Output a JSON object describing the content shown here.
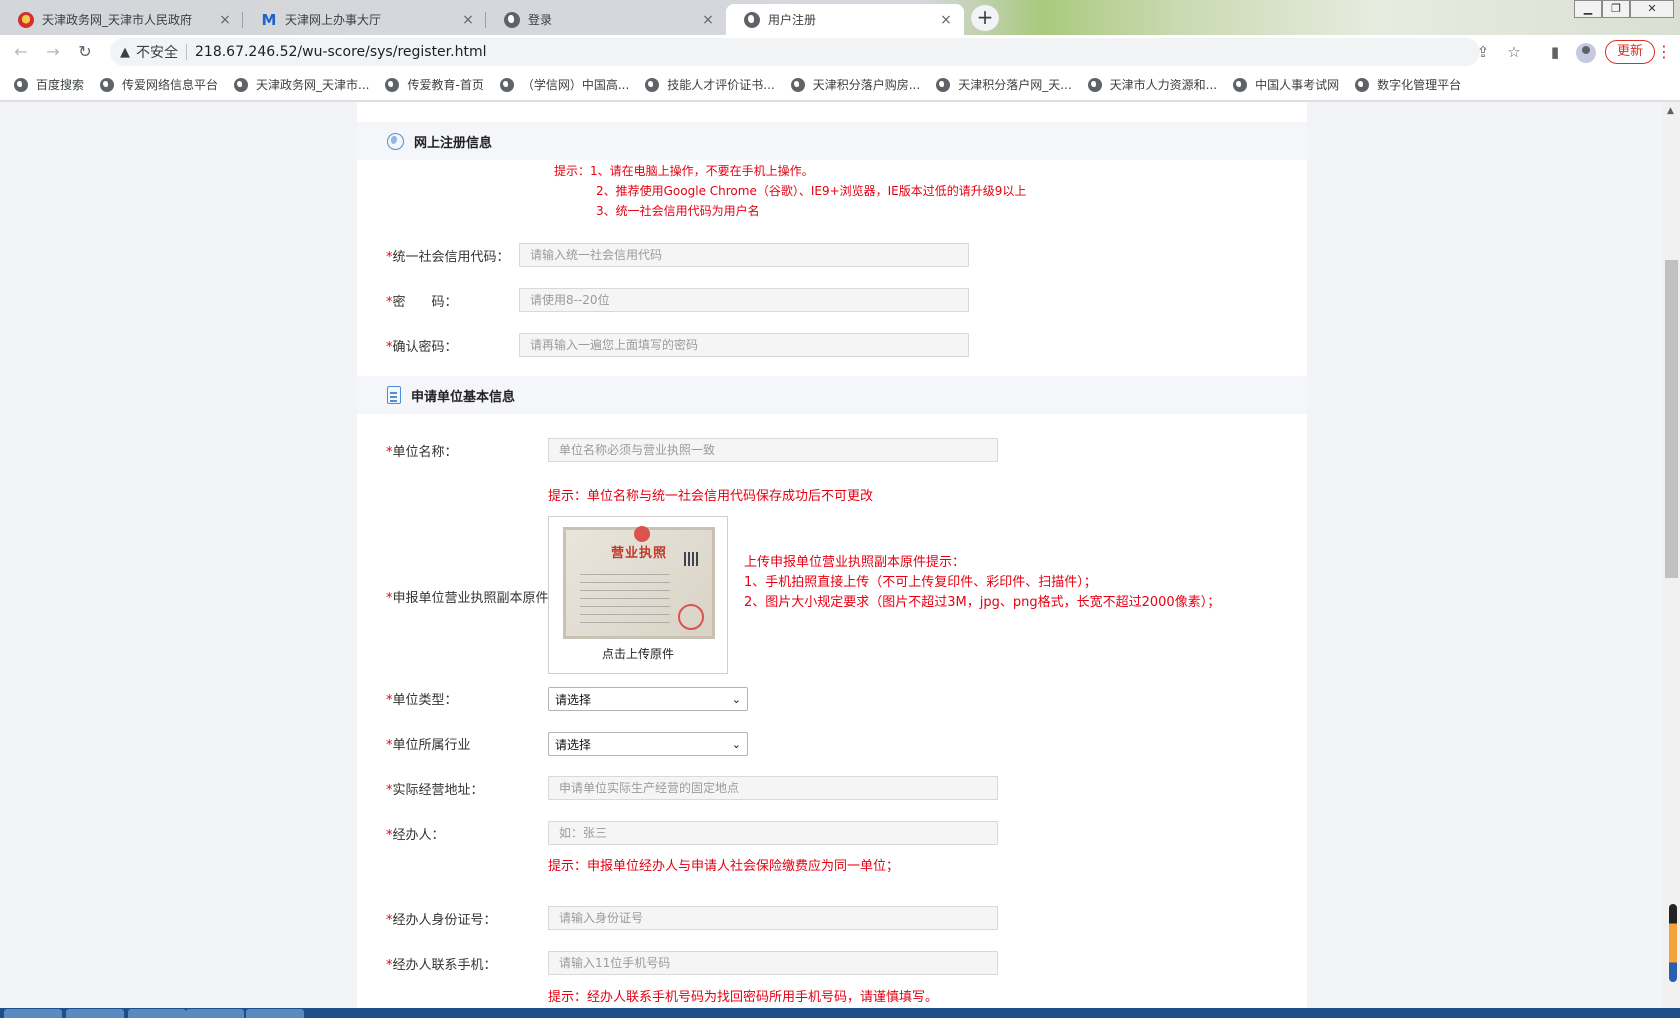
{
  "browser": {
    "tabs": [
      {
        "title": "天津政务网_天津市人民政府",
        "icon": "gov-emblem-icon"
      },
      {
        "title": "天津网上办事大厅",
        "icon": "m-logo-icon"
      },
      {
        "title": "登录",
        "icon": "globe-icon"
      },
      {
        "title": "用户注册",
        "icon": "globe-icon"
      }
    ],
    "close_glyph": "×",
    "new_tab_glyph": "+",
    "security_text": "不安全",
    "url": "218.67.246.52/wu-score/sys/register.html",
    "update_label": "更新",
    "bookmarks": [
      "百度搜索",
      "传爱网络信息平台",
      "天津政务网_天津市...",
      "传爱教育-首页",
      "（学信网）中国高...",
      "技能人才评价证书...",
      "天津积分落户购房...",
      "天津积分落户网_天...",
      "天津市人力资源和...",
      "中国人事考试网",
      "数字化管理平台"
    ]
  },
  "page": {
    "section1": {
      "title": "网上注册信息",
      "tips": [
        "提示：1、请在电脑上操作，不要在手机上操作。",
        "2、推荐使用Google Chrome（谷歌）、IE9+浏览器，IE版本过低的请升级9以上",
        "3、统一社会信用代码为用户名"
      ],
      "fields": [
        {
          "label": "统一社会信用代码：",
          "placeholder": "请输入统一社会信用代码"
        },
        {
          "label": "密　　码：",
          "placeholder": "请使用8--20位"
        },
        {
          "label": "确认密码：",
          "placeholder": "请再输入一遍您上面填写的密码"
        }
      ]
    },
    "section2": {
      "title": "申请单位基本信息",
      "unit_name": {
        "label": "单位名称：",
        "placeholder": "单位名称必须与营业执照一致"
      },
      "unit_name_tip": "提示：单位名称与统一社会信用代码保存成功后不可更改",
      "license": {
        "label": "申报单位营业执照副本原件",
        "image_title": "营业执照",
        "upload_caption": "点击上传原件",
        "tips": [
          "上传申报单位营业执照副本原件提示：",
          "1、手机拍照直接上传（不可上传复印件、彩印件、扫描件）；",
          "2、图片大小规定要求（图片不超过3M，jpg、png格式，长宽不超过2000像素）；"
        ]
      },
      "unit_type": {
        "label": "单位类型：",
        "selected": "请选择"
      },
      "unit_industry": {
        "label": "单位所属行业",
        "selected": "请选择"
      },
      "address": {
        "label": "实际经营地址：",
        "placeholder": "申请单位实际生产经营的固定地点"
      },
      "handler": {
        "label": "经办人：",
        "placeholder": "如：张三"
      },
      "handler_tip": "提示：申报单位经办人与申请人社会保险缴费应为同一单位；",
      "handler_id": {
        "label": "经办人身份证号：",
        "placeholder": "请输入身份证号"
      },
      "handler_phone": {
        "label": "经办人联系手机：",
        "placeholder": "请输入11位手机号码"
      },
      "handler_phone_tip": "提示：经办人联系手机号码为找回密码所用手机号码，请谨慎填写。"
    },
    "required_mark": "*"
  },
  "colors": {
    "accent_red": "#e60012",
    "icon_blue": "#4a90d9",
    "panel_bg": "#ffffff",
    "page_bg": "#f3f4f7"
  }
}
